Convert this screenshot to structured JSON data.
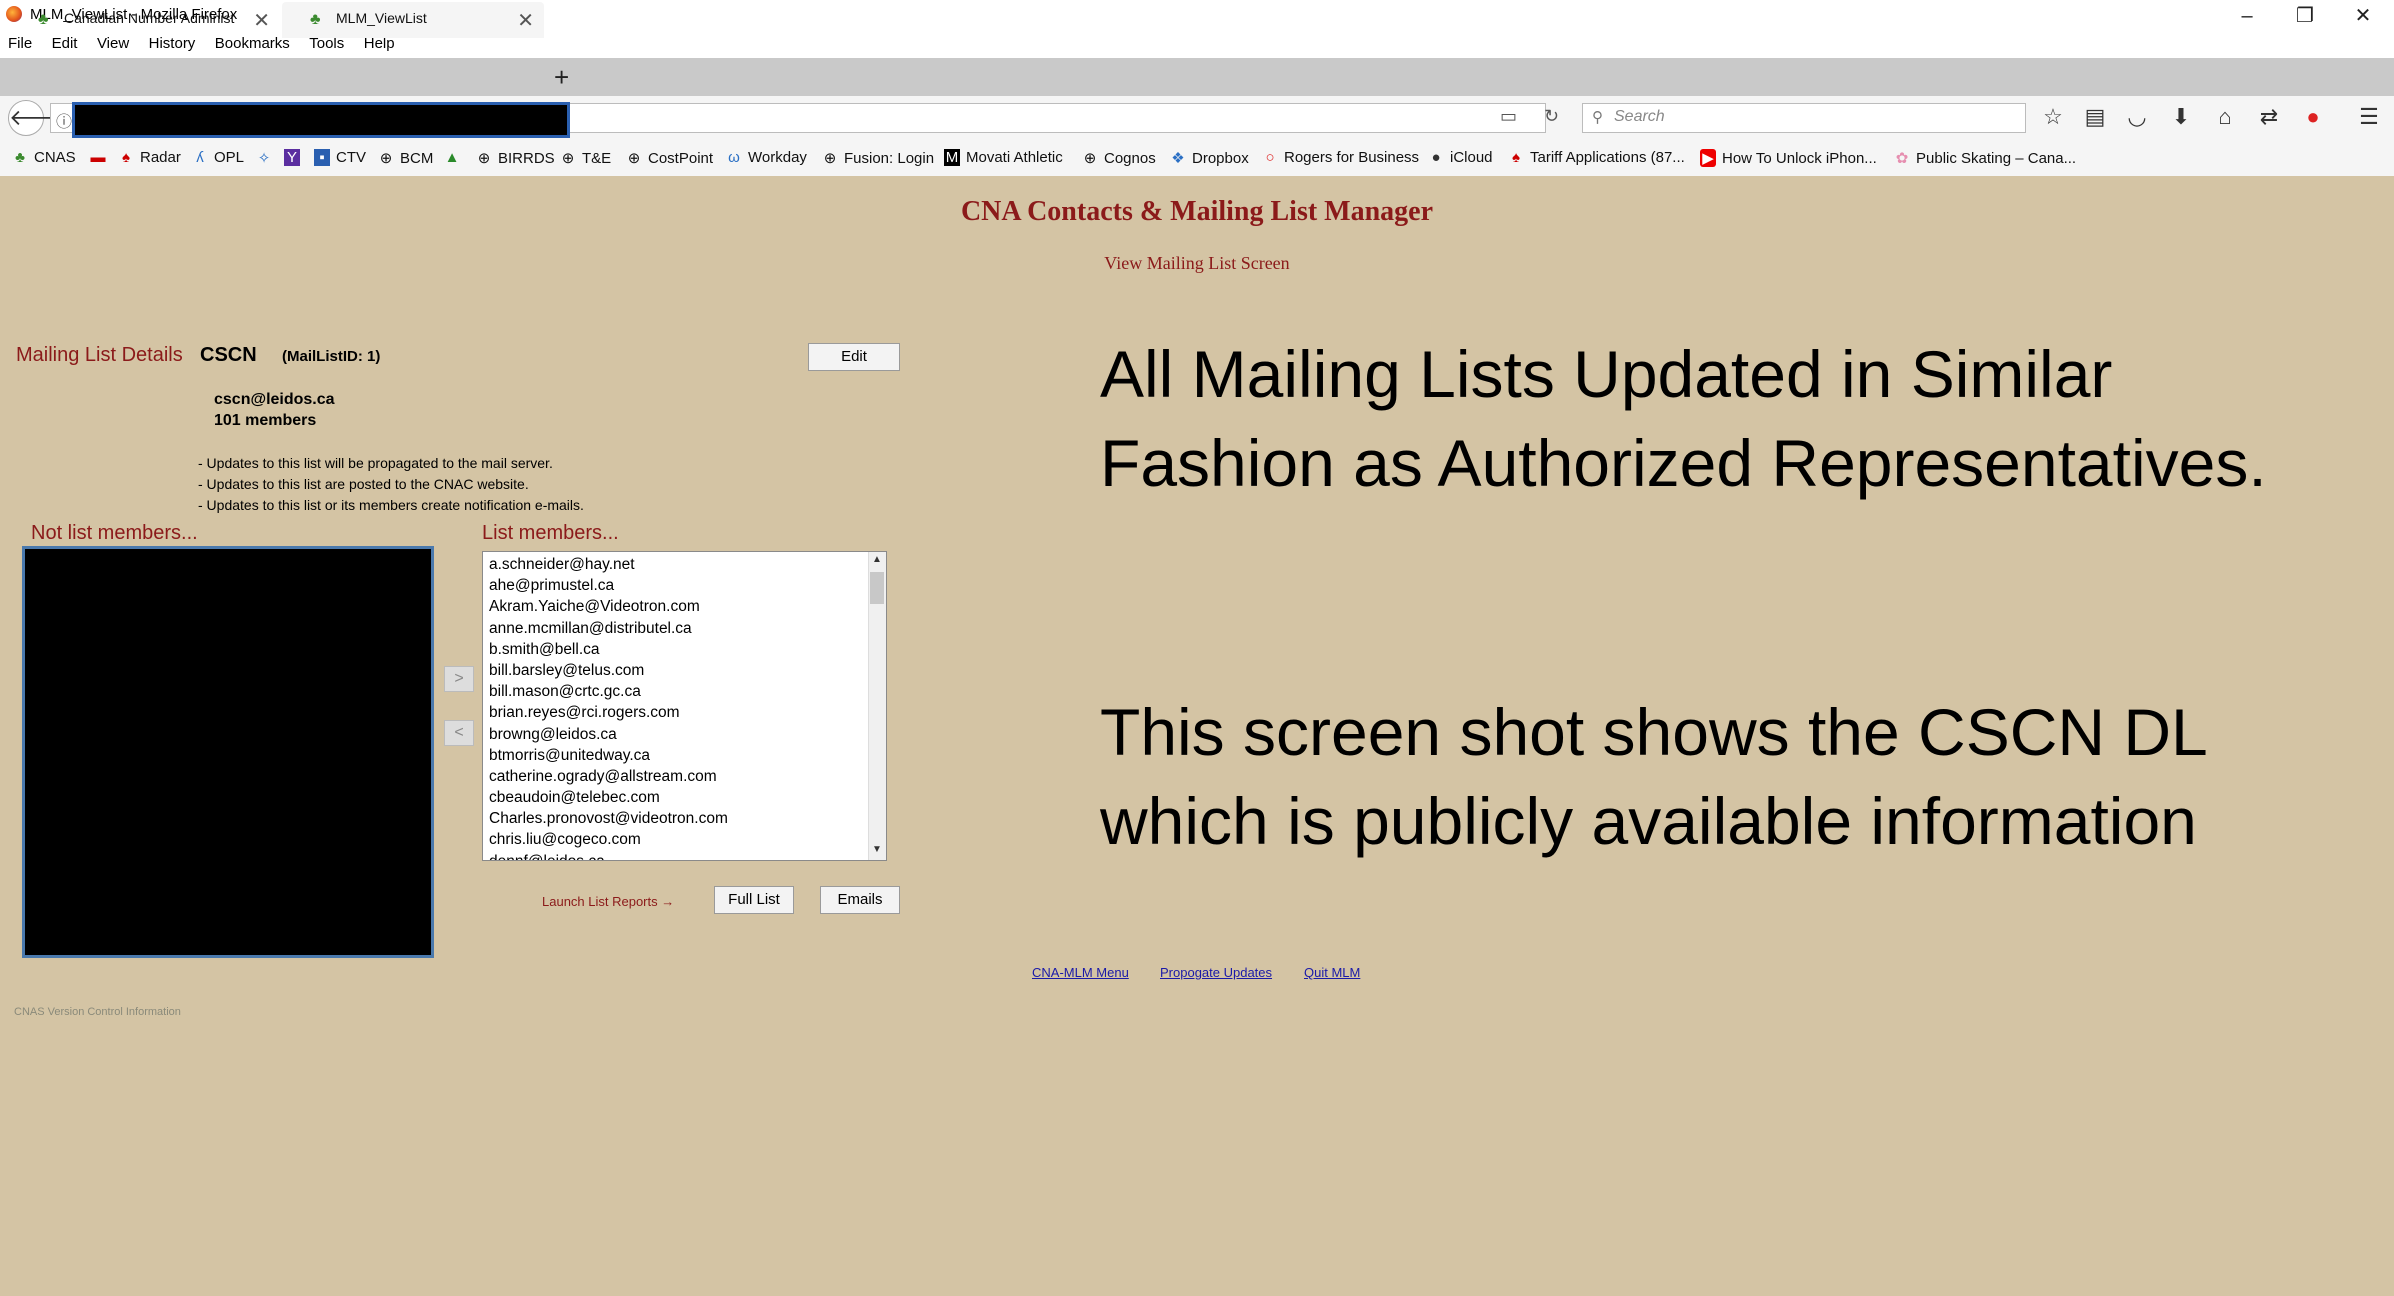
{
  "window": {
    "title": "MLM_ViewList - Mozilla Firefox",
    "minimize": "–",
    "restore": "❐",
    "close": "✕"
  },
  "menu": [
    "File",
    "Edit",
    "View",
    "History",
    "Bookmarks",
    "Tools",
    "Help"
  ],
  "tabs": [
    {
      "title": "Canadian Number Administ"
    },
    {
      "title": "MLM_ViewList"
    }
  ],
  "new_tab": "+",
  "search": {
    "placeholder": "Search"
  },
  "bookmarks": [
    "CNAS",
    "Radar",
    "OPL",
    "CTV",
    "BCM",
    "BIRRDS",
    "T&E",
    "CostPoint",
    "Workday",
    "Fusion: Login",
    "Movati Athletic",
    "Cognos",
    "Dropbox",
    "Rogers for Business",
    "iCloud",
    "Tariff Applications (87...",
    "How To Unlock iPhon...",
    "Public Skating – Cana..."
  ],
  "page": {
    "title": "CNA Contacts & Mailing List Manager",
    "subtitle": "View Mailing List Screen",
    "details_label": "Mailing List Details",
    "list_name": "CSCN",
    "list_id": "(MailListID: 1)",
    "edit_label": "Edit",
    "list_email": "cscn@leidos.ca",
    "member_count": "101 members",
    "notes": [
      "- Updates to this list will be propagated to the mail server.",
      "- Updates to this list are posted to the CNAC website.",
      "- Updates to this list or its members create notification e-mails."
    ],
    "not_members_label": "Not list members...",
    "members_label": "List members...",
    "add_arrow": ">",
    "remove_arrow": "<",
    "members": [
      "a.schneider@hay.net",
      "ahe@primustel.ca",
      "Akram.Yaiche@Videotron.com",
      "anne.mcmillan@distributel.ca",
      "b.smith@bell.ca",
      "bill.barsley@telus.com",
      "bill.mason@crtc.gc.ca",
      "brian.reyes@rci.rogers.com",
      "browng@leidos.ca",
      "btmorris@unitedway.ca",
      "catherine.ogrady@allstream.com",
      "cbeaudoin@telebec.com",
      "Charles.pronovost@videotron.com",
      "chris.liu@cogeco.com",
      "dennf@leidos.ca"
    ],
    "launch_label": "Launch List Reports  →",
    "full_list_label": "Full List",
    "emails_label": "Emails",
    "version_label": "CNAS Version Control Information",
    "footer_links": [
      "CNA-MLM Menu",
      "Propogate Updates",
      "Quit MLM"
    ]
  },
  "overlay": {
    "line1": "All Mailing Lists Updated in Similar Fashion as Authorized Representatives.",
    "line2": "This screen shot shows the CSCN DL which is publicly available information"
  }
}
